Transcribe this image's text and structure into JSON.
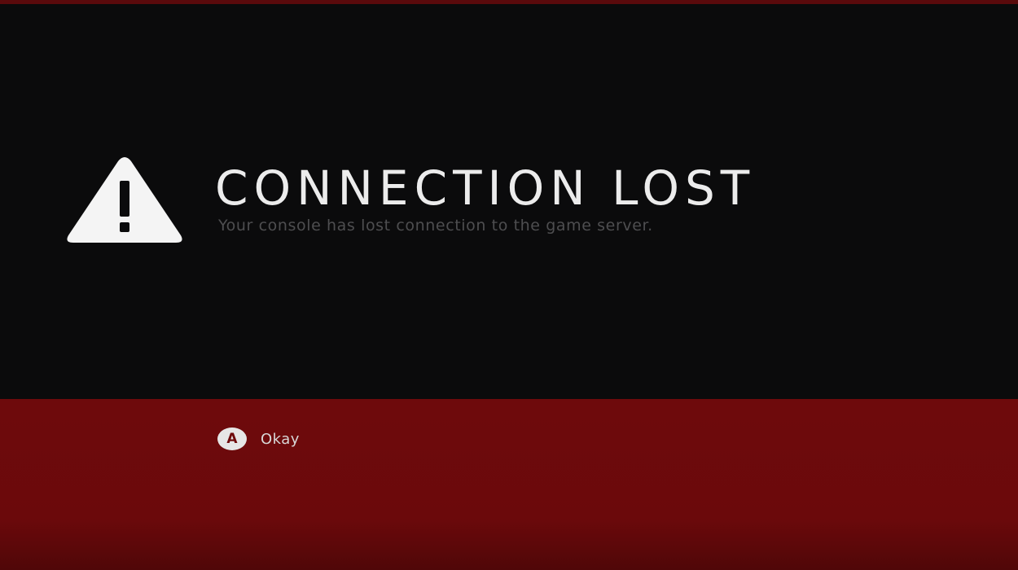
{
  "dialog": {
    "icon": "warning-triangle-icon",
    "title": "CONNECTION LOST",
    "message": "Your console has lost connection to the game server."
  },
  "actions": {
    "confirm": {
      "button_glyph": "A",
      "label": "Okay"
    }
  },
  "colors": {
    "background": "#0b0b0c",
    "footer_red": "#6e0a0c",
    "title_text": "#ececec",
    "message_text": "#4e4e50",
    "icon_fill": "#f4f4f4"
  }
}
